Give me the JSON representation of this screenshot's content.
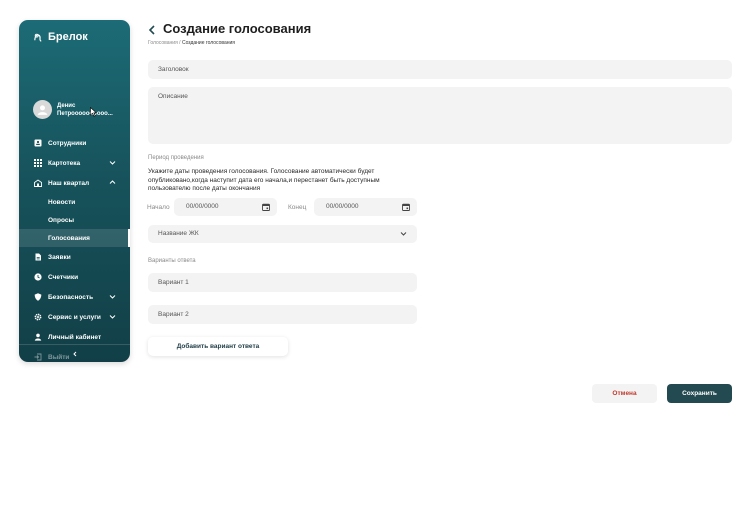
{
  "sidebar": {
    "brand": "Брелок",
    "user_name": "Денис Петроооооооооо...",
    "items": [
      {
        "label": "Сотрудники",
        "icon": "badge-icon"
      },
      {
        "label": "Картотека",
        "icon": "grid-icon"
      },
      {
        "label": "Наш квартал",
        "icon": "buildings-icon"
      },
      {
        "label": "Заявки",
        "icon": "document-icon"
      },
      {
        "label": "Счетчики",
        "icon": "clock-icon"
      },
      {
        "label": "Безопасность",
        "icon": "shield-icon"
      },
      {
        "label": "Сервис и услуги",
        "icon": "gear-icon"
      },
      {
        "label": "Личный кабинет",
        "icon": "user-icon"
      },
      {
        "label": "Выйти",
        "icon": "logout-icon"
      }
    ],
    "subitems": [
      {
        "label": "Новости"
      },
      {
        "label": "Опросы"
      },
      {
        "label": "Голосования"
      }
    ]
  },
  "header": {
    "title": "Создание голосования",
    "breadcrumb_parent": "Голосования",
    "breadcrumb_separator": " / ",
    "breadcrumb_current": "Создание голосования"
  },
  "form": {
    "title_placeholder": "Заголовок",
    "description_placeholder": "Описание",
    "period_label": "Период проведения",
    "period_hint": "Укажите даты проведения голосования. Голосование автоматически  будет опубликовано,когда наступит дата его начала,и  перестанет быть доступным пользователю после даты окончания",
    "start_label": "Начало",
    "start_value": "00/00/0000",
    "end_label": "Конец",
    "end_value": "00/00/0000",
    "complex_placeholder": "Название ЖК",
    "variants_label": "Варианты ответа",
    "variants": [
      "Вариант 1",
      "Вариант 2"
    ],
    "add_variant": "Добавить вариант ответа"
  },
  "actions": {
    "cancel": "Отмена",
    "save": "Сохранить"
  },
  "colors": {
    "sidebar": "#17535c",
    "primary_button": "#234a50",
    "cancel_text": "#c0392b"
  }
}
